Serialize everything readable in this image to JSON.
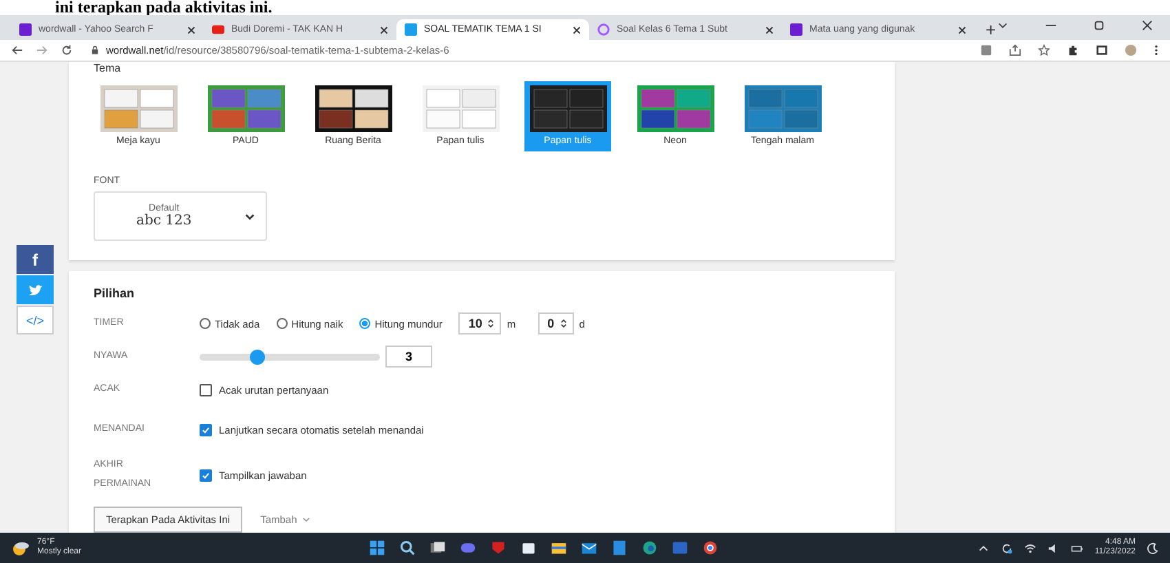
{
  "page_heading": "ini terapkan pada aktivitas ini.",
  "browser": {
    "tabs": [
      {
        "title": "wordwall - Yahoo Search F",
        "kind": "yahoo",
        "selected": false
      },
      {
        "title": "Budi Doremi - TAK KAN H",
        "kind": "video",
        "selected": false
      },
      {
        "title": "SOAL TEMATIK TEMA 1 SI",
        "kind": "grid",
        "selected": true
      },
      {
        "title": "Soal Kelas 6 Tema 1 Subt",
        "kind": "ring",
        "selected": false
      },
      {
        "title": "Mata uang yang digunak",
        "kind": "yahoo",
        "selected": false
      }
    ],
    "new_tab": "+",
    "domain": "wordwall.net",
    "path": "/id/resource/38580796/soal-tematik-tema-1-subtema-2-kelas-6"
  },
  "share": [
    {
      "kind": "facebook",
      "glyph": "f"
    },
    {
      "kind": "twitter"
    },
    {
      "kind": "embed",
      "glyph": "</>"
    }
  ],
  "theme_section": {
    "title": "Tema",
    "themes": [
      {
        "label": "Meja kayu",
        "kind": "wood",
        "selected": false
      },
      {
        "label": "PAUD",
        "kind": "paud",
        "selected": false
      },
      {
        "label": "Ruang Berita",
        "kind": "news",
        "selected": false
      },
      {
        "label": "Papan tulis",
        "kind": "whiteboard",
        "selected": false
      },
      {
        "label": "Papan tulis",
        "kind": "chalkboard",
        "selected": true
      },
      {
        "label": "Neon",
        "kind": "neon",
        "selected": false
      },
      {
        "label": "Tengah malam",
        "kind": "midnight",
        "selected": false
      }
    ],
    "font": {
      "label": "FONT",
      "value": "Default",
      "sample": "abc 123"
    }
  },
  "options": {
    "title": "Pilihan",
    "timer": {
      "label": "TIMER",
      "radios": [
        {
          "label": "Tidak ada",
          "selected": false
        },
        {
          "label": "Hitung naik",
          "selected": false
        },
        {
          "label": "Hitung mundur",
          "selected": true
        }
      ],
      "minutes": "10",
      "minutes_unit": "m",
      "seconds": "0",
      "seconds_unit": "d"
    },
    "lives": {
      "label": "NYAWA",
      "level": 0.32,
      "value": "3"
    },
    "checks": [
      {
        "label": "ACAK",
        "text": "Acak urutan pertanyaan",
        "checked": false
      },
      {
        "label": "MENANDAI",
        "text": "Lanjutkan secara otomatis setelah menandai",
        "checked": true
      },
      {
        "label": "AKHIR PERMAINAN",
        "text": "Tampilkan jawaban",
        "checked": true
      }
    ],
    "apply_button": "Terapkan Pada Aktivitas Ini",
    "more_button": "Tambah"
  },
  "taskbar": {
    "temperature": "76°F",
    "weather": "Mostly clear",
    "time": "4:48 AM",
    "date": "11/23/2022"
  }
}
